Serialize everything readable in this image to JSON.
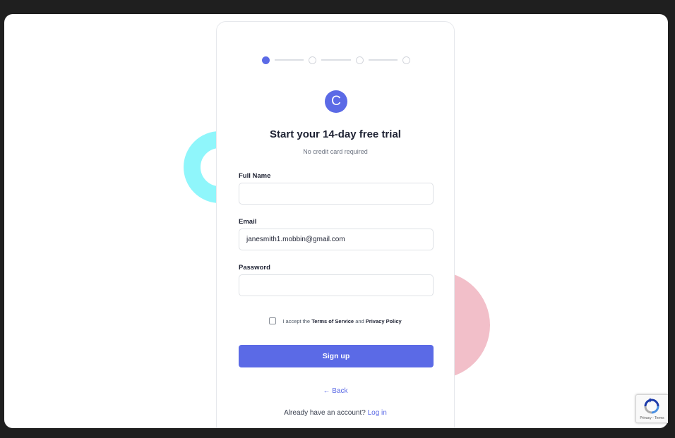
{
  "steps": {
    "total": 4,
    "current": 1
  },
  "brand": {
    "logo_letter": "C"
  },
  "form": {
    "title": "Start your 14-day free trial",
    "subtitle": "No credit card required",
    "full_name": {
      "label": "Full Name",
      "value": "",
      "placeholder": ""
    },
    "email": {
      "label": "Email",
      "value": "janesmith1.mobbin@gmail.com",
      "placeholder": ""
    },
    "password": {
      "label": "Password",
      "value": "",
      "placeholder": ""
    },
    "terms": {
      "checked": false,
      "prefix": "I accept the",
      "tos": "Terms of Service",
      "and": "and",
      "privacy": "Privacy Policy"
    },
    "submit_label": "Sign up",
    "back_label": "← Back",
    "login_prompt": "Already have an account?",
    "login_link": "Log in"
  },
  "recaptcha": {
    "text": "Privacy - Terms"
  },
  "colors": {
    "accent": "#5b6ae6",
    "deco_ring": "#8ff6fb",
    "deco_circle": "#f2bfc9",
    "backdrop": "#1f1f1f"
  }
}
